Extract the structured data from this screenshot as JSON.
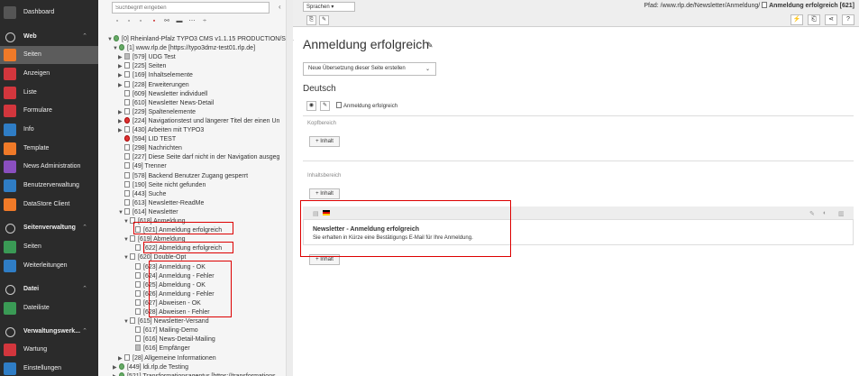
{
  "sidebar": {
    "items": [
      {
        "label": "Dashboard",
        "icon": "dashboard-icon",
        "color": "#555555"
      },
      {
        "label": "Web",
        "icon": "web-group-icon",
        "group": true
      },
      {
        "label": "Seiten",
        "icon": "page-module-icon",
        "color": "#f07a28",
        "active": true
      },
      {
        "label": "Anzeigen",
        "icon": "view-icon",
        "color": "#d2363d"
      },
      {
        "label": "Liste",
        "icon": "list-icon",
        "color": "#d2363d"
      },
      {
        "label": "Formulare",
        "icon": "forms-icon",
        "color": "#d2363d"
      },
      {
        "label": "Info",
        "icon": "info-icon",
        "color": "#2f7dc5"
      },
      {
        "label": "Template",
        "icon": "template-icon",
        "color": "#f07a28"
      },
      {
        "label": "News Administration",
        "icon": "news-icon",
        "color": "#8a4fbf"
      },
      {
        "label": "Benutzerverwaltung",
        "icon": "users-icon",
        "color": "#2f7dc5"
      },
      {
        "label": "DataStore Client",
        "icon": "datastore-icon",
        "color": "#f07a28"
      },
      {
        "label": "Seitenverwaltung",
        "icon": "pagemgmt-group-icon",
        "group": true
      },
      {
        "label": "Seiten",
        "icon": "pages-icon",
        "color": "#3a9a55"
      },
      {
        "label": "Weiterleitungen",
        "icon": "redirects-icon",
        "color": "#2f7dc5"
      },
      {
        "label": "Datei",
        "icon": "file-group-icon",
        "group": true
      },
      {
        "label": "Dateiliste",
        "icon": "filelist-icon",
        "color": "#3a9a55"
      },
      {
        "label": "Verwaltungswerk...",
        "icon": "admin-group-icon",
        "group": true
      },
      {
        "label": "Wartung",
        "icon": "maintenance-icon",
        "color": "#d2363d"
      },
      {
        "label": "Einstellungen",
        "icon": "settings-icon",
        "color": "#2f7dc5"
      }
    ]
  },
  "tree": {
    "search_placeholder": "Suchbegriff eingeben",
    "nodes": [
      {
        "text": "[0] Rheinland-Pfalz TYPO3 CMS v1.1.15 PRODUCTION/STA",
        "expander": "▼",
        "icon": "root-icon"
      },
      {
        "text": "[1] www.rlp.de [https://typo3dmz-test01.rlp.de]",
        "expander": "▼",
        "icon": "globe"
      },
      {
        "text": "[579] UDG Test",
        "expander": "▶",
        "icon": "folder"
      },
      {
        "text": "[225] Seiten",
        "expander": "▶",
        "icon": "page"
      },
      {
        "text": "[169] Inhaltselemente",
        "expander": "▶",
        "icon": "page"
      },
      {
        "text": "[228] Erweiterungen",
        "expander": "▶",
        "icon": "page"
      },
      {
        "text": "[609] Newsletter individuell",
        "expander": "",
        "icon": "page"
      },
      {
        "text": "[610] Newsletter News-Detail",
        "expander": "",
        "icon": "page"
      },
      {
        "text": "[229] Spaltenelemente",
        "expander": "▶",
        "icon": "page"
      },
      {
        "text": "[224] Navigationstest und längerer Titel der einen Un",
        "expander": "▶",
        "icon": "red"
      },
      {
        "text": "[430] Arbeiten mit TYPO3",
        "expander": "▶",
        "icon": "page"
      },
      {
        "text": "[594] LID TEST",
        "expander": "",
        "icon": "red"
      },
      {
        "text": "[298] Nachrichten",
        "expander": "",
        "icon": "page"
      },
      {
        "text": "[227] Diese Seite darf nicht in der Navigation ausgeg",
        "expander": "",
        "icon": "page"
      },
      {
        "text": "[49] Trenner",
        "expander": "",
        "icon": "divider"
      },
      {
        "text": "[578] Backend Benutzer Zugang gesperrt",
        "expander": "",
        "icon": "page"
      },
      {
        "text": "[190] Seite nicht gefunden",
        "expander": "",
        "icon": "page"
      },
      {
        "text": "[443] Suche",
        "expander": "",
        "icon": "page"
      },
      {
        "text": "[613] Newsletter-ReadMe",
        "expander": "",
        "icon": "page"
      },
      {
        "text": "[614] Newsletter",
        "expander": "▼",
        "icon": "page"
      },
      {
        "text": "[618] Anmeldung",
        "expander": "▼",
        "icon": "page"
      },
      {
        "text": "[621] Anmeldung erfolgreich",
        "expander": "",
        "icon": "page"
      },
      {
        "text": "[619] Abmeldung",
        "expander": "▼",
        "icon": "page"
      },
      {
        "text": "[622] Abmeldung erfolgreich",
        "expander": "",
        "icon": "page"
      },
      {
        "text": "[620] Double-Opt",
        "expander": "▼",
        "icon": "page"
      },
      {
        "text": "[623] Anmeldung - OK",
        "expander": "",
        "icon": "page"
      },
      {
        "text": "[624] Anmeldung - Fehler",
        "expander": "",
        "icon": "page"
      },
      {
        "text": "[625] Abmeldung - OK",
        "expander": "",
        "icon": "page"
      },
      {
        "text": "[626] Anmeldung - Fehler",
        "expander": "",
        "icon": "page"
      },
      {
        "text": "[627] Abweisen - OK",
        "expander": "",
        "icon": "page"
      },
      {
        "text": "[628] Abweisen - Fehler",
        "expander": "",
        "icon": "page"
      },
      {
        "text": "[615] Newsletter-Versand",
        "expander": "▼",
        "icon": "page"
      },
      {
        "text": "[617] Mailing-Demo",
        "expander": "",
        "icon": "page"
      },
      {
        "text": "[616] News-Detail-Mailing",
        "expander": "",
        "icon": "page"
      },
      {
        "text": "[616] Empfänger",
        "expander": "",
        "icon": "folder"
      },
      {
        "text": "[28] Allgemeine Informationen",
        "expander": "▶",
        "icon": "page"
      },
      {
        "text": "[449] ldi.rlp.de Testing",
        "expander": "▶",
        "icon": "globe"
      },
      {
        "text": "[521] Transformationsagentur [https://transformations",
        "expander": "▶",
        "icon": "globe"
      }
    ]
  },
  "header": {
    "language_select": "Sprachen",
    "path_prefix": "Pfad: /www.rlp.de/Newsletter/Anmeldung/",
    "path_current": "Anmeldung erfolgreich [621]"
  },
  "content": {
    "page_title": "Anmeldung erfolgreich",
    "new_translation": "Neue Übersetzung dieser Seite erstellen",
    "language_heading": "Deutsch",
    "page_name": "Anmeldung erfolgreich",
    "header_area": "Kopfbereich",
    "content_area": "Inhaltsbereich",
    "add_content": "Inhalt",
    "element_title": "Newsletter - Anmeldung erfolgreich",
    "element_text": "Sie erhalten in Kürze eine Bestätigungs E-Mail für Ihre Anmeldung."
  }
}
